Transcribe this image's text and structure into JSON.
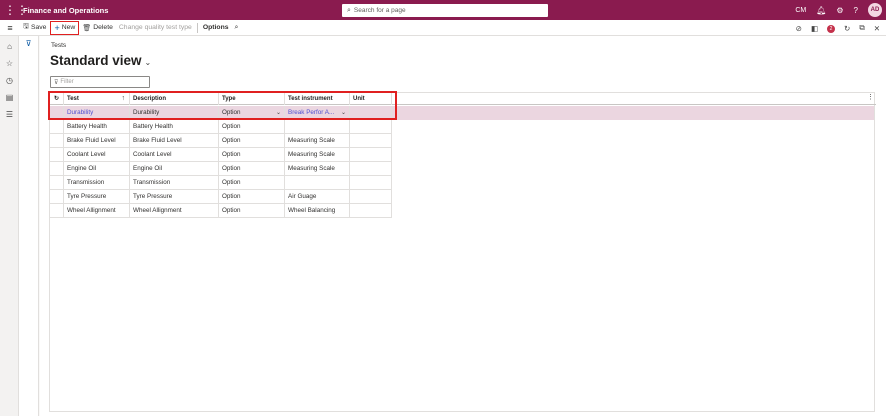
{
  "app": {
    "title": "Finance and Operations",
    "search_placeholder": "Search for a page",
    "company": "CM",
    "user_initials": "AD",
    "notification_count": "2"
  },
  "toolbar": {
    "save_label": "Save",
    "new_label": "New",
    "delete_label": "Delete",
    "change_label": "Change quality test type",
    "options_label": "Options"
  },
  "page": {
    "breadcrumb": "Tests",
    "view_title": "Standard view",
    "filter_placeholder": "Filter"
  },
  "grid": {
    "columns": [
      "Test",
      "Description",
      "Type",
      "Test instrument",
      "Unit"
    ],
    "rows": [
      {
        "test": "Durability",
        "description": "Durability",
        "type": "Option",
        "instrument": "Break Perfor A...",
        "unit": ""
      },
      {
        "test": "Battery Health",
        "description": "Battery Health",
        "type": "Option",
        "instrument": "",
        "unit": ""
      },
      {
        "test": "Brake Fluid Level",
        "description": "Brake Fluid Level",
        "type": "Option",
        "instrument": "Measuring Scale",
        "unit": ""
      },
      {
        "test": "Coolant Level",
        "description": "Coolant Level",
        "type": "Option",
        "instrument": "Measuring Scale",
        "unit": ""
      },
      {
        "test": "Engine Oil",
        "description": "Engine Oil",
        "type": "Option",
        "instrument": "Measuring Scale",
        "unit": ""
      },
      {
        "test": "Transmission",
        "description": "Transmission",
        "type": "Option",
        "instrument": "",
        "unit": ""
      },
      {
        "test": "Tyre Pressure",
        "description": "Tyre Pressure",
        "type": "Option",
        "instrument": "Air Guage",
        "unit": ""
      },
      {
        "test": "Wheel Allignment",
        "description": "Wheel Allignment",
        "type": "Option",
        "instrument": "Wheel Balancing",
        "unit": ""
      }
    ]
  },
  "colors": {
    "brand": "#8a1b4f",
    "selected_row": "#ebd6e0",
    "highlight": "#e02020",
    "link": "#4f4fd1"
  }
}
